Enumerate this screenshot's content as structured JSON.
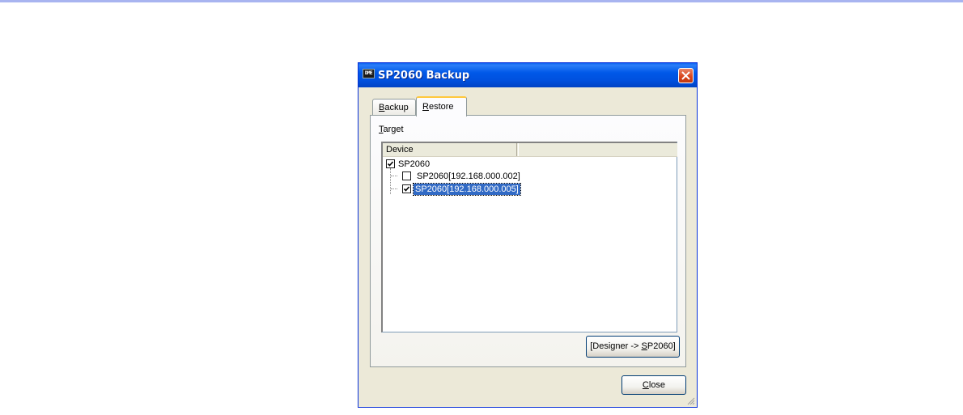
{
  "window": {
    "title": "SP2060 Backup",
    "icon_text": "DME"
  },
  "tabs": [
    {
      "label_prefix": "",
      "label_mnemonic": "B",
      "label_rest": "ackup",
      "active": false
    },
    {
      "label_prefix": "",
      "label_mnemonic": "R",
      "label_rest": "estore",
      "active": true
    }
  ],
  "target": {
    "label_mnemonic": "T",
    "label_rest": "arget"
  },
  "listview": {
    "columns": [
      "Device",
      ""
    ],
    "tree": {
      "root": {
        "label": "SP2060",
        "checked": true
      },
      "children": [
        {
          "label": "SP2060[192.168.000.002]",
          "checked": false,
          "selected": false
        },
        {
          "label": "SP2060[192.168.000.005]",
          "checked": true,
          "selected": true
        }
      ]
    }
  },
  "buttons": {
    "designer_prefix": "[Designer -> ",
    "designer_mnemonic": "S",
    "designer_rest": "P2060]",
    "close_mnemonic": "C",
    "close_rest": "lose"
  },
  "colors": {
    "titlebar": "#0058e8",
    "selection": "#316ac5",
    "window_bg": "#ece9d8"
  }
}
